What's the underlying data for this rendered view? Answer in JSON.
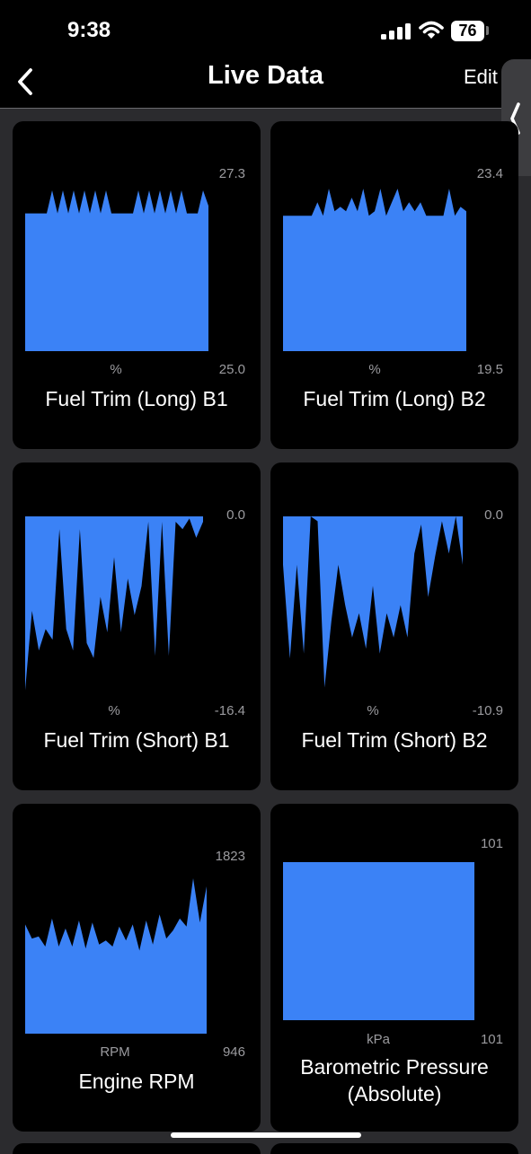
{
  "status_bar": {
    "time": "9:38",
    "battery": "76"
  },
  "nav": {
    "title": "Live Data",
    "edit_label": "Edit"
  },
  "colors": {
    "accent": "#3b82f6",
    "card_bg": "#000000",
    "page_bg": "#2b2b2e",
    "muted_text": "#9b9b9f"
  },
  "icons": {
    "back": "chevron-left-icon",
    "side_handle": "chevron-left-icon"
  },
  "cards": [
    {
      "name": "Fuel Trim (Long) B1",
      "unit": "%",
      "max_label": "27.3",
      "min_label": "25.0",
      "chart_data": {
        "type": "area",
        "ylim": [
          25.0,
          27.3
        ],
        "fill": "from-min",
        "values": [
          26.8,
          26.8,
          26.8,
          26.8,
          26.8,
          27.1,
          26.8,
          27.1,
          26.8,
          27.1,
          26.8,
          27.1,
          26.8,
          27.1,
          26.8,
          27.1,
          26.8,
          26.8,
          26.8,
          26.8,
          26.8,
          27.1,
          26.8,
          27.1,
          26.8,
          27.1,
          26.8,
          27.1,
          26.8,
          27.1,
          26.8,
          26.8,
          26.8,
          27.1,
          26.9
        ]
      }
    },
    {
      "name": "Fuel Trim (Long) B2",
      "unit": "%",
      "max_label": "23.4",
      "min_label": "19.5",
      "chart_data": {
        "type": "area",
        "ylim": [
          19.5,
          23.4
        ],
        "fill": "from-min",
        "values": [
          22.5,
          22.5,
          22.5,
          22.5,
          22.5,
          22.5,
          22.8,
          22.5,
          23.1,
          22.6,
          22.7,
          22.6,
          22.9,
          22.6,
          23.1,
          22.5,
          22.6,
          23.1,
          22.5,
          22.8,
          23.1,
          22.6,
          22.8,
          22.6,
          22.8,
          22.5,
          22.5,
          22.5,
          22.5,
          23.1,
          22.5,
          22.7,
          22.6
        ]
      }
    },
    {
      "name": "Fuel Trim (Short) B1",
      "unit": "%",
      "max_label": "0.0",
      "min_label": "-16.4",
      "chart_data": {
        "type": "area",
        "ylim": [
          -16.4,
          0.0
        ],
        "fill": "from-max",
        "values": [
          -16.2,
          -8.8,
          -12.5,
          -10.5,
          -11.5,
          -1.2,
          -10.5,
          -12.5,
          -1.2,
          -11.8,
          -13.2,
          -7.5,
          -10.8,
          -3.8,
          -10.8,
          -5.8,
          -9.2,
          -6.5,
          -0.5,
          -13.0,
          -0.5,
          -13.0,
          -0.5,
          -1.2,
          -0.2,
          -2.0,
          -0.5
        ]
      }
    },
    {
      "name": "Fuel Trim (Short) B2",
      "unit": "%",
      "max_label": "0.0",
      "min_label": "-10.9",
      "chart_data": {
        "type": "area",
        "ylim": [
          -10.9,
          0.0
        ],
        "fill": "from-max",
        "values": [
          -3.0,
          -8.8,
          -3.0,
          -8.5,
          0.0,
          -0.3,
          -10.6,
          -6.5,
          -3.0,
          -5.5,
          -7.5,
          -6.0,
          -8.2,
          -4.3,
          -8.5,
          -6.0,
          -7.5,
          -5.5,
          -7.5,
          -2.3,
          -0.5,
          -5.0,
          -2.5,
          -0.3,
          -2.3,
          0.0,
          -3.0
        ]
      }
    },
    {
      "name": "Engine RPM",
      "unit": "RPM",
      "max_label": "1823",
      "min_label": "946",
      "chart_data": {
        "type": "area",
        "ylim": [
          946,
          1823
        ],
        "fill": "from-min",
        "values": [
          1490,
          1420,
          1430,
          1380,
          1520,
          1380,
          1470,
          1380,
          1510,
          1370,
          1500,
          1390,
          1410,
          1380,
          1480,
          1410,
          1490,
          1360,
          1510,
          1390,
          1540,
          1420,
          1460,
          1520,
          1480,
          1720,
          1500,
          1680
        ]
      }
    },
    {
      "name": "Barometric Pressure (Absolute)",
      "unit": "kPa",
      "max_label": "101",
      "min_label": "101",
      "chart_data": {
        "type": "area",
        "ylim": [
          101,
          101
        ],
        "fill": "full",
        "values": [
          101,
          101,
          101,
          101,
          101,
          101,
          101,
          101,
          101,
          101
        ]
      }
    }
  ]
}
